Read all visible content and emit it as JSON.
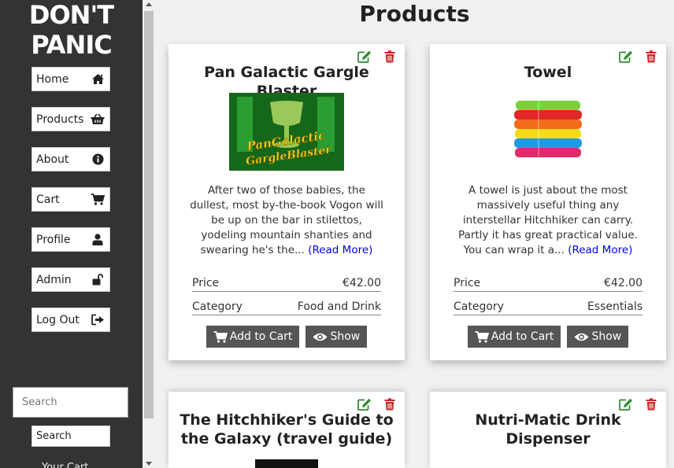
{
  "sidebar": {
    "logo_line1": "DON'T",
    "logo_line2": "PANIC",
    "nav": [
      {
        "label": "Home",
        "icon": "home-icon"
      },
      {
        "label": "Products",
        "icon": "basket-icon"
      },
      {
        "label": "About",
        "icon": "info-icon"
      },
      {
        "label": "Cart",
        "icon": "cart-icon"
      },
      {
        "label": "Profile",
        "icon": "user-icon"
      },
      {
        "label": "Admin",
        "icon": "unlock-icon"
      },
      {
        "label": "Log Out",
        "icon": "sign-out-icon"
      }
    ],
    "search_placeholder": "Search",
    "search_button": "Search",
    "cut_text": "Your Cart"
  },
  "main": {
    "title": "Products",
    "products": [
      {
        "name": "Pan Galactic Gargle Blaster",
        "image_text": "Pan Galactic Gargle Blaster",
        "description": "After two of those babies, the dullest, most by-the-book Vogon will be up on the bar in stilettos, yodeling mountain shanties and swearing he's the...",
        "read_more": "(Read More)",
        "price_label": "Price",
        "price": "€42.00",
        "category_label": "Category",
        "category": "Food and Drink",
        "add_to_cart": "Add to Cart",
        "show": "Show"
      },
      {
        "name": "Towel",
        "description": "A towel is just about the most massively useful thing any interstellar Hitchhiker can carry. Partly it has great practical value. You can wrap it a...",
        "read_more": "(Read More)",
        "price_label": "Price",
        "price": "€42.00",
        "category_label": "Category",
        "category": "Essentials",
        "add_to_cart": "Add to Cart",
        "show": "Show"
      },
      {
        "name": "The Hitchhiker's Guide to the Galaxy (travel guide)"
      },
      {
        "name": "Nutri-Matic Drink Dispenser"
      }
    ]
  },
  "colors": {
    "sidebar_bg": "#333333",
    "edit_icon": "#2e8b2e",
    "delete_icon": "#c62828",
    "button_bg": "#555555"
  }
}
